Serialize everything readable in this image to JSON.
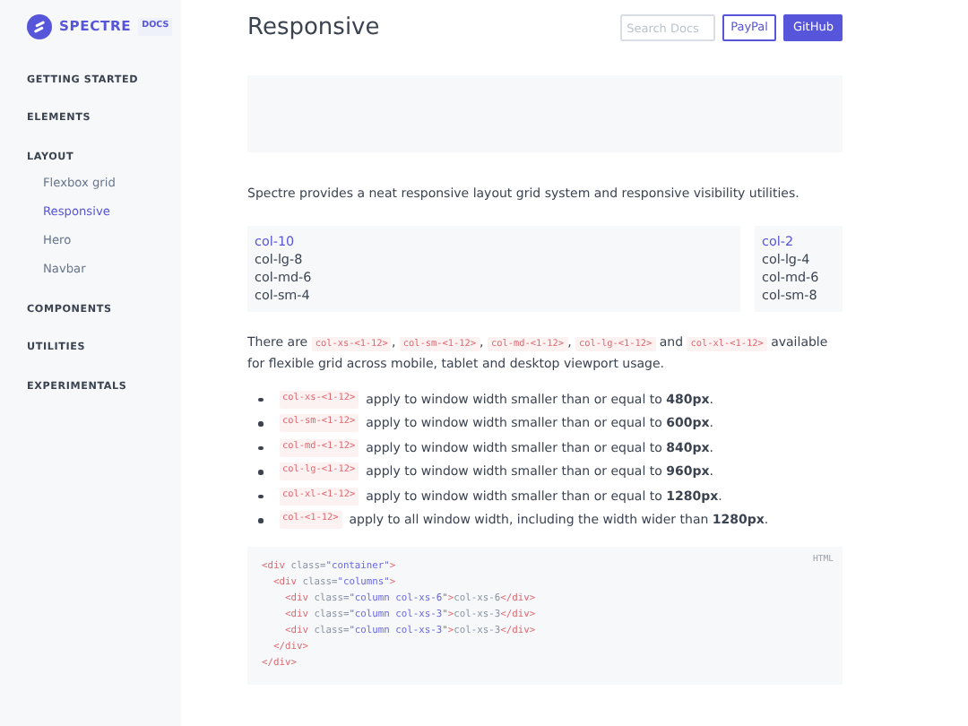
{
  "brand": {
    "name": "SPECTRE",
    "tag": "DOCS"
  },
  "sidebar": {
    "items": [
      {
        "label": "GETTING STARTED"
      },
      {
        "label": "ELEMENTS"
      },
      {
        "label": "LAYOUT",
        "children": [
          {
            "label": "Flexbox grid",
            "selected": false
          },
          {
            "label": "Responsive",
            "selected": true
          },
          {
            "label": "Hero",
            "selected": false
          },
          {
            "label": "Navbar",
            "selected": false
          }
        ]
      },
      {
        "label": "COMPONENTS"
      },
      {
        "label": "UTILITIES"
      },
      {
        "label": "EXPERIMENTALS"
      }
    ]
  },
  "header": {
    "title": "Responsive",
    "search": {
      "placeholder": "Search Docs"
    },
    "buttons": [
      {
        "label": "PayPal",
        "kind": "outline"
      },
      {
        "label": "GitHub",
        "kind": "primary"
      }
    ]
  },
  "intro": "Spectre provides a neat responsive layout grid system and responsive visibility utilities.",
  "demo_columns": [
    {
      "items": [
        {
          "text": "col-10",
          "highlight": true
        },
        {
          "text": "col-lg-8",
          "highlight": false
        },
        {
          "text": "col-md-6",
          "highlight": false
        },
        {
          "text": "col-sm-4",
          "highlight": false
        }
      ]
    },
    {
      "items": [
        {
          "text": "col-2",
          "highlight": true
        },
        {
          "text": "col-lg-4",
          "highlight": false
        },
        {
          "text": "col-md-6",
          "highlight": false
        },
        {
          "text": "col-sm-8",
          "highlight": false
        }
      ]
    }
  ],
  "description": [
    {
      "kind": "text",
      "text": "There are "
    },
    {
      "kind": "code",
      "text": "col-xs-<1-12>"
    },
    {
      "kind": "text",
      "text": ", "
    },
    {
      "kind": "code",
      "text": "col-sm-<1-12>"
    },
    {
      "kind": "text",
      "text": ", "
    },
    {
      "kind": "code",
      "text": "col-md-<1-12>"
    },
    {
      "kind": "text",
      "text": ", "
    },
    {
      "kind": "code",
      "text": "col-lg-<1-12>"
    },
    {
      "kind": "text",
      "text": " and "
    },
    {
      "kind": "code",
      "text": "col-xl-<1-12>"
    },
    {
      "kind": "text",
      "text": " available for flexible grid across mobile, tablet and desktop viewport usage."
    }
  ],
  "bullets": [
    {
      "code": "col-xs-<1-12>",
      "text": "apply to window width smaller than or equal to **480px**."
    },
    {
      "code": "col-sm-<1-12>",
      "text": "apply to window width smaller than or equal to **600px**."
    },
    {
      "code": "col-md-<1-12>",
      "text": "apply to window width smaller than or equal to **840px**."
    },
    {
      "code": "col-lg-<1-12>",
      "text": "apply to window width smaller than or equal to **960px**."
    },
    {
      "code": "col-xl-<1-12>",
      "text": "apply to window width smaller than or equal to **1280px**."
    },
    {
      "code": "col-<1-12>",
      "text": "apply to all window width, including the width wider than **1280px**."
    }
  ],
  "code_block": {
    "language": "HTML",
    "lines": [
      [
        {
          "kind": "tag",
          "text": "<div"
        },
        {
          "kind": "plain",
          "text": " class="
        },
        {
          "kind": "string",
          "text": "\"container\""
        },
        {
          "kind": "tag",
          "text": ">"
        }
      ],
      [
        {
          "kind": "tag",
          "text": "  <div"
        },
        {
          "kind": "plain",
          "text": " class="
        },
        {
          "kind": "string",
          "text": "\"columns\""
        },
        {
          "kind": "tag",
          "text": ">"
        }
      ],
      [
        {
          "kind": "tag",
          "text": "    <div"
        },
        {
          "kind": "plain",
          "text": " class="
        },
        {
          "kind": "string",
          "text": "\"column col-xs-6\""
        },
        {
          "kind": "tag",
          "text": ">"
        },
        {
          "kind": "plain",
          "text": "col-xs-6"
        },
        {
          "kind": "tag",
          "text": "</div>"
        }
      ],
      [
        {
          "kind": "tag",
          "text": "    <div"
        },
        {
          "kind": "plain",
          "text": " class="
        },
        {
          "kind": "string",
          "text": "\"column col-xs-3\""
        },
        {
          "kind": "tag",
          "text": ">"
        },
        {
          "kind": "plain",
          "text": "col-xs-3"
        },
        {
          "kind": "tag",
          "text": "</div>"
        }
      ],
      [
        {
          "kind": "tag",
          "text": "    <div"
        },
        {
          "kind": "plain",
          "text": " class="
        },
        {
          "kind": "string",
          "text": "\"column col-xs-3\""
        },
        {
          "kind": "tag",
          "text": ">"
        },
        {
          "kind": "plain",
          "text": "col-xs-3"
        },
        {
          "kind": "tag",
          "text": "</div>"
        }
      ],
      [
        {
          "kind": "tag",
          "text": "  </div>"
        }
      ],
      [
        {
          "kind": "tag",
          "text": "</div>"
        }
      ]
    ]
  }
}
